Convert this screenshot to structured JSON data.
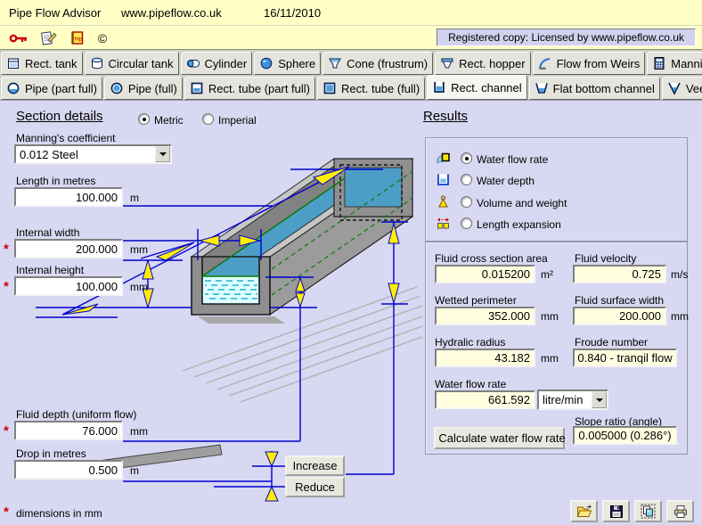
{
  "header": {
    "app_title": "Pipe Flow Advisor",
    "website": "www.pipeflow.co.uk",
    "date": "16/11/2010",
    "registered": "Registered copy: Licensed by www.pipeflow.co.uk",
    "copyright_glyph": "©",
    "help_icon_text": "hlp"
  },
  "tabs": {
    "row1": [
      "Rect. tank",
      "Circular tank",
      "Cylinder",
      "Sphere",
      "Cone (frustrum)",
      "Rect. hopper",
      "Flow from Weirs",
      "Manning calculator"
    ],
    "row2": [
      "Pipe (part full)",
      "Pipe (full)",
      "Rect. tube (part full)",
      "Rect. tube (full)",
      "Rect. channel",
      "Flat bottom channel",
      "Vee channel"
    ],
    "active_tab": "Rect. channel"
  },
  "section": {
    "heading": "Section details",
    "metric_label": "Metric",
    "imperial_label": "Imperial",
    "manning_label": "Manning's coefficient",
    "manning_value": "0.012  Steel",
    "length_label": "Length  in metres",
    "length_value": "100.000",
    "length_unit": "m",
    "width_label": "Internal width",
    "width_value": "200.000",
    "width_unit": "mm",
    "height_label": "Internal height",
    "height_value": "100.000",
    "height_unit": "mm",
    "depth_label": "Fluid depth (uniform flow)",
    "depth_value": "76.000",
    "depth_unit": "mm",
    "drop_label": "Drop  in metres",
    "drop_value": "0.500",
    "drop_unit": "m",
    "required_marker": "*",
    "footnote": "dimensions in mm",
    "increase_label": "Increase",
    "reduce_label": "Reduce"
  },
  "results": {
    "heading": "Results",
    "options": [
      "Water flow rate",
      "Water depth",
      "Volume and weight",
      "Length expansion"
    ],
    "selected_option": "Water flow rate",
    "cross_section_label": "Fluid cross section area",
    "cross_section_value": "0.015200",
    "cross_section_unit": "m²",
    "velocity_label": "Fluid velocity",
    "velocity_value": "0.725",
    "velocity_unit": "m/s",
    "wetted_label": "Wetted perimeter",
    "wetted_value": "352.000",
    "wetted_unit": "mm",
    "surface_width_label": "Fluid surface width",
    "surface_width_value": "200.000",
    "surface_width_unit": "mm",
    "hydraulic_label": "Hydralic radius",
    "hydraulic_value": "43.182",
    "hydraulic_unit": "mm",
    "froude_label": "Froude number",
    "froude_value": "0.840 - tranqil flow",
    "flow_label": "Water flow rate",
    "flow_value": "661.592",
    "flow_unit_selected": "litre/min",
    "calculate_label": "Calculate water flow rate",
    "slope_label": "Slope ratio (angle)",
    "slope_value": "0.005000 (0.286°)"
  },
  "icon_glyphs": {
    "copyright-icon": "©",
    "dropdown-arrow-icon": "▼",
    "key-icon": "red key shape",
    "register-icon": "notepad with pencil",
    "help-icon": "yellow help book",
    "open-file-icon": "open folder",
    "save-icon": "floppy disk",
    "copy-image-icon": "overlapping pictures",
    "print-icon": "printer"
  }
}
